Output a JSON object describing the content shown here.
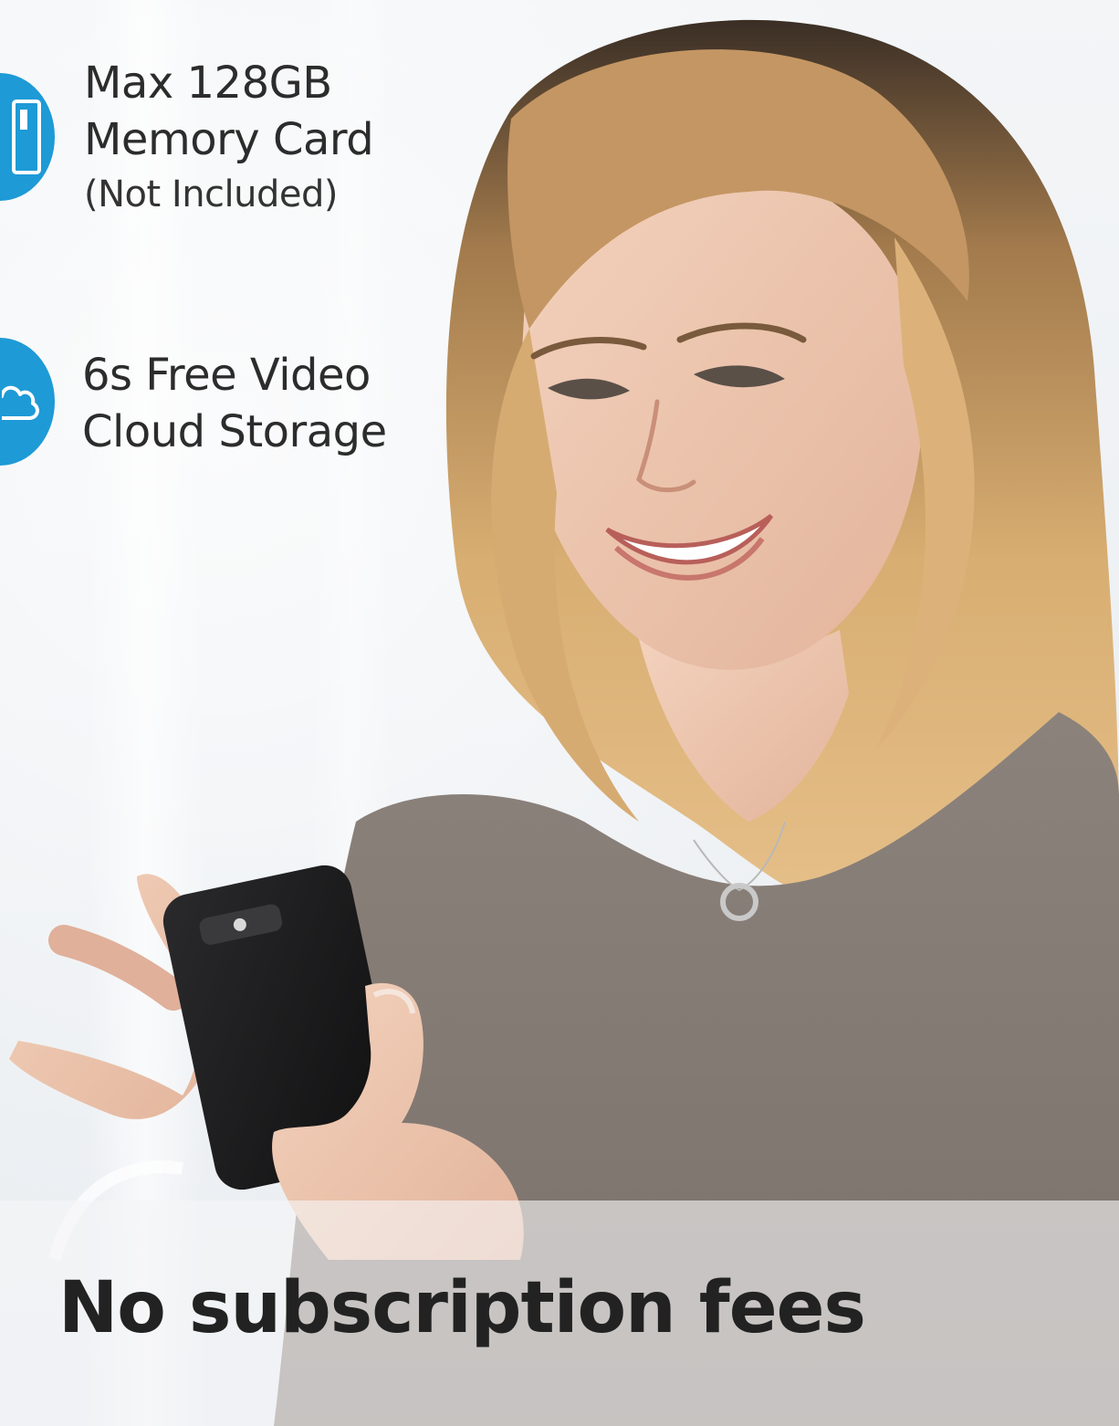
{
  "features": [
    {
      "icon": "memory-card-icon",
      "lines": [
        "Max 128GB",
        "Memory Card"
      ],
      "note": "(Not Included)"
    },
    {
      "icon": "cloud-icon",
      "lines": [
        "6s Free Video",
        "Cloud Storage"
      ]
    }
  ],
  "banner": {
    "text": "No subscription fees"
  },
  "colors": {
    "accent": "#1e9ad6",
    "text": "#2c2c2c"
  }
}
